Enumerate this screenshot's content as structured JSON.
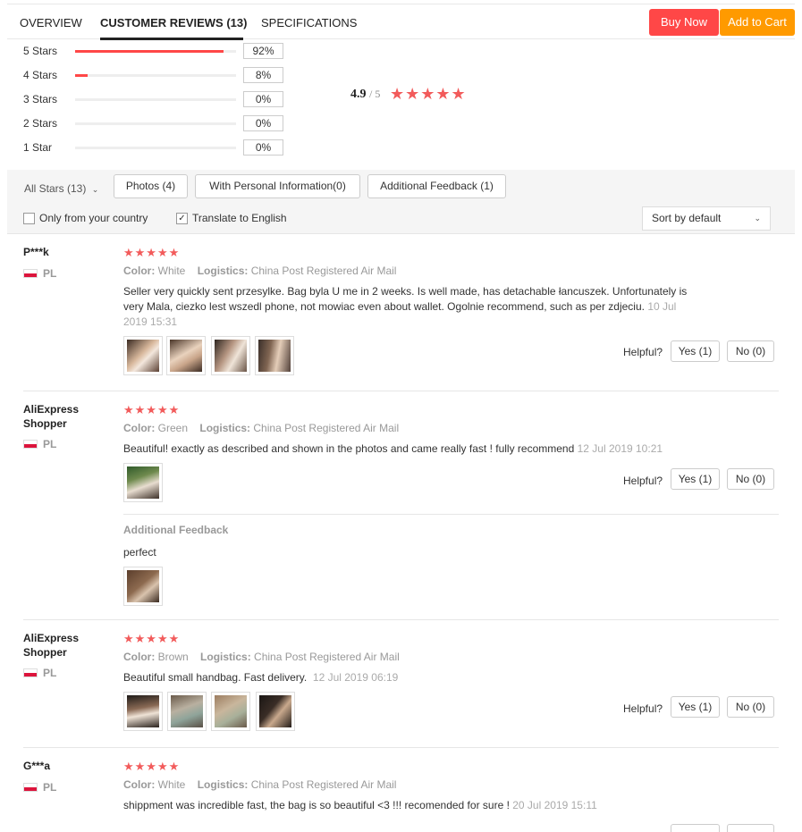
{
  "tabs": [
    {
      "label": "OVERVIEW"
    },
    {
      "label": "CUSTOMER REVIEWS (13)"
    },
    {
      "label": "SPECIFICATIONS"
    }
  ],
  "actions": {
    "buy_now": "Buy Now",
    "add_to_cart": "Add to Cart"
  },
  "colors": {
    "accent_red": "#ff4747",
    "accent_orange": "#ff9a00",
    "star": "#f25b5b"
  },
  "histogram": [
    {
      "label": "5 Stars",
      "percent": "92%",
      "fraction": 0.92
    },
    {
      "label": "4 Stars",
      "percent": "8%",
      "fraction": 0.08
    },
    {
      "label": "3 Stars",
      "percent": "0%",
      "fraction": 0
    },
    {
      "label": "2 Stars",
      "percent": "0%",
      "fraction": 0
    },
    {
      "label": "1 Star",
      "percent": "0%",
      "fraction": 0
    }
  ],
  "rating": {
    "score": "4.9",
    "max": "/ 5",
    "stars": 5
  },
  "filters": {
    "all_stars": "All Stars (13)",
    "photos": "Photos (4)",
    "with_personal_info": "With Personal Information(0)",
    "additional_feedback": "Additional Feedback (1)",
    "only_country": "Only from your country",
    "translate": "Translate to English",
    "sort": "Sort by default"
  },
  "labels": {
    "color": "Color:",
    "logistics": "Logistics:",
    "helpful": "Helpful?",
    "additional_feedback": "Additional Feedback"
  },
  "reviews": [
    {
      "user": "P***k",
      "country": "PL",
      "stars": 5,
      "color": "White",
      "logistics": "China Post Registered Air Mail",
      "text": "Seller very quickly sent przesylke. Bag byla U me in 2 weeks. Is well made, has detachable łancuszek. Unfortunately is very Mala, ciezko lest wszedl phone, not mowiac even about wallet. Ogolnie recommend, such as per zdjeciu.",
      "date": "10 Jul 2019 15:31",
      "yes": "Yes (1)",
      "no": "No (0)"
    },
    {
      "user": "AliExpress Shopper",
      "country": "PL",
      "stars": 5,
      "color": "Green",
      "logistics": "China Post Registered Air Mail",
      "text": "Beautiful! exactly as described and shown in the photos and came really fast ! fully recommend",
      "date": "12 Jul 2019 10:21",
      "yes": "Yes (1)",
      "no": "No (0)",
      "additional": "perfect"
    },
    {
      "user": "AliExpress Shopper",
      "country": "PL",
      "stars": 5,
      "color": "Brown",
      "logistics": "China Post Registered Air Mail",
      "text": "Beautiful small handbag. Fast delivery.",
      "date": "12 Jul 2019 06:19",
      "yes": "Yes (1)",
      "no": "No (0)"
    },
    {
      "user": "G***a",
      "country": "PL",
      "stars": 5,
      "color": "White",
      "logistics": "China Post Registered Air Mail",
      "text": "shippment was incredible fast, the bag is so beautiful <3 !!! recomended for sure !",
      "date": "20 Jul 2019 15:11"
    }
  ]
}
